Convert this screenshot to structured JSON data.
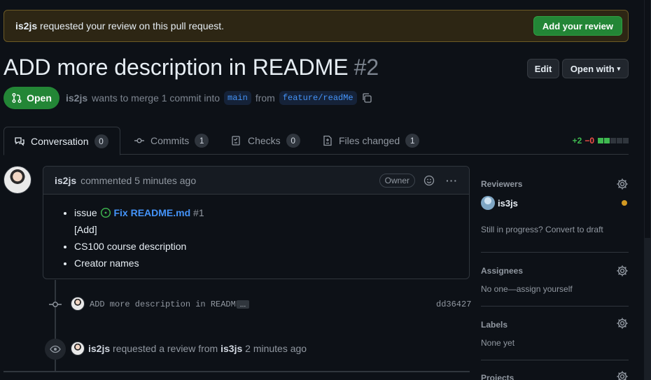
{
  "banner": {
    "user": "is2js",
    "text": "requested your review on this pull request.",
    "button": "Add your review"
  },
  "pr": {
    "title": "ADD more description in README",
    "number": "#2",
    "state": "Open",
    "author": "is2js",
    "merge_text_1": "wants to merge 1 commit into",
    "base": "main",
    "from": "from",
    "head": "feature/readMe"
  },
  "toolbar": {
    "edit": "Edit",
    "open_with": "Open with"
  },
  "tabs": [
    {
      "label": "Conversation",
      "count": "0"
    },
    {
      "label": "Commits",
      "count": "1"
    },
    {
      "label": "Checks",
      "count": "0"
    },
    {
      "label": "Files changed",
      "count": "1"
    }
  ],
  "diffstat": {
    "add": "+2",
    "del": "−0"
  },
  "comment": {
    "author": "is2js",
    "action": "commented 5 minutes ago",
    "badge": "Owner",
    "items": {
      "issue_prefix": "issue",
      "issue_title": "Fix README.md",
      "issue_num": "#1",
      "add": "[Add]",
      "course": "CS100 course description",
      "creators": "Creator names"
    }
  },
  "commit": {
    "message": "ADD more description in README",
    "more": "…",
    "sha": "dd36427"
  },
  "review_event": {
    "user": "is2js",
    "text": "requested a review from",
    "reviewer": "is3js",
    "time": "2 minutes ago"
  },
  "sidebar": {
    "reviewers": {
      "title": "Reviewers",
      "name": "is3js",
      "draft": "Still in progress? Convert to draft"
    },
    "assignees": {
      "title": "Assignees",
      "value": "No one—assign yourself"
    },
    "labels": {
      "title": "Labels",
      "value": "None yet"
    },
    "projects": {
      "title": "Projects"
    }
  },
  "colors": {
    "green": "#238636",
    "blue": "#4493f8",
    "add": "#3fb950",
    "del": "#f85149",
    "pending": "#d29922"
  }
}
